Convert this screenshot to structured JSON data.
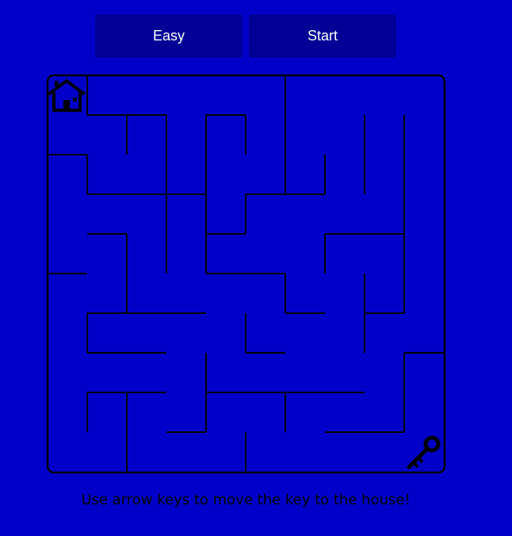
{
  "controls": {
    "level_label": "Easy",
    "start_label": "Start"
  },
  "instructions": "Use arrow keys to move the key to the house!",
  "maze": {
    "columns": 10,
    "rows": 10,
    "goal_icon": "house-icon",
    "player_icon": "key-icon",
    "colors": {
      "background": "#0000c8",
      "button": "#000096",
      "walls": "#000000",
      "button_text": "#ffffff"
    }
  }
}
